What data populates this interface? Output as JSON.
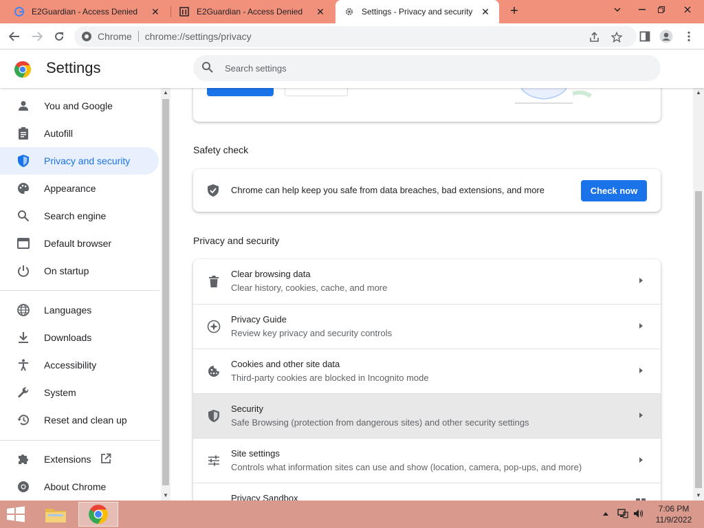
{
  "window": {
    "tabs": [
      {
        "title": "E2Guardian - Access Denied",
        "favicon": "google-g-icon",
        "active": false
      },
      {
        "title": "E2Guardian - Access Denied",
        "favicon": "bank-icon",
        "active": false
      },
      {
        "title": "Settings - Privacy and security",
        "favicon": "gear-icon",
        "active": true
      }
    ],
    "close_glyph": "✕",
    "new_tab_glyph": "+",
    "tab_strip_color": "#f1917b"
  },
  "toolbar": {
    "omnibox_label": "Chrome",
    "url": "chrome://settings/privacy"
  },
  "header": {
    "title": "Settings",
    "search_placeholder": "Search settings"
  },
  "sidebar": {
    "items": [
      {
        "label": "You and Google",
        "icon": "person-icon"
      },
      {
        "label": "Autofill",
        "icon": "clipboard-icon"
      },
      {
        "label": "Privacy and security",
        "icon": "shield-icon",
        "active": true
      },
      {
        "label": "Appearance",
        "icon": "palette-icon"
      },
      {
        "label": "Search engine",
        "icon": "search-icon"
      },
      {
        "label": "Default browser",
        "icon": "browser-icon"
      },
      {
        "label": "On startup",
        "icon": "power-icon"
      },
      {
        "label": "Languages",
        "icon": "globe-icon"
      },
      {
        "label": "Downloads",
        "icon": "download-icon"
      },
      {
        "label": "Accessibility",
        "icon": "accessibility-icon"
      },
      {
        "label": "System",
        "icon": "wrench-icon"
      },
      {
        "label": "Reset and clean up",
        "icon": "history-icon"
      },
      {
        "label": "Extensions",
        "icon": "puzzle-icon"
      },
      {
        "label": "About Chrome",
        "icon": "chrome-icon"
      }
    ]
  },
  "main": {
    "safety_check": {
      "title": "Safety check",
      "description": "Chrome can help keep you safe from data breaches, bad extensions, and more",
      "button": "Check now"
    },
    "privacy": {
      "title": "Privacy and security",
      "rows": [
        {
          "title": "Clear browsing data",
          "subtitle": "Clear history, cookies, cache, and more",
          "icon": "trash-icon"
        },
        {
          "title": "Privacy Guide",
          "subtitle": "Review key privacy and security controls",
          "icon": "compass-icon"
        },
        {
          "title": "Cookies and other site data",
          "subtitle": "Third-party cookies are blocked in Incognito mode",
          "icon": "cookie-icon"
        },
        {
          "title": "Security",
          "subtitle": "Safe Browsing (protection from dangerous sites) and other security settings",
          "icon": "shield-icon"
        },
        {
          "title": "Site settings",
          "subtitle": "Controls what information sites can use and show (location, camera, pop-ups, and more)",
          "icon": "sliders-icon"
        },
        {
          "title": "Privacy Sandbox",
          "subtitle": "",
          "icon": "sandbox-icon"
        }
      ]
    }
  },
  "taskbar": {
    "time": "7:06 PM",
    "date": "11/9/2022",
    "color": "#d99a8d"
  },
  "colors": {
    "accent": "#1a73e8",
    "active_bg": "#e8f0fe"
  }
}
